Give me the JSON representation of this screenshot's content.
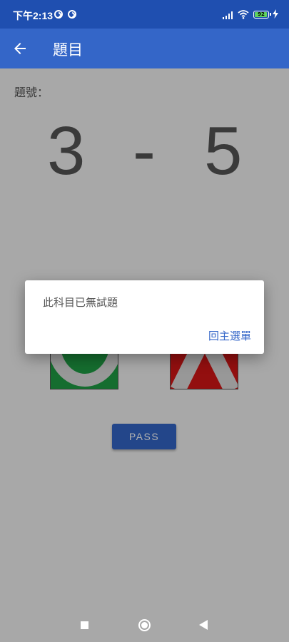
{
  "status_bar": {
    "time": "下午2:13",
    "battery_level": "92"
  },
  "app_bar": {
    "title": "題目",
    "back_icon": "arrow-left-icon"
  },
  "content": {
    "question_number_label": "題號：",
    "question_number": {
      "chapter": "3",
      "separator": "-",
      "number": "5"
    },
    "answer_options": [
      {
        "name": "correct-o",
        "color": "#1f9e44"
      },
      {
        "name": "wrong-x",
        "color": "#d61616"
      }
    ],
    "pass_button": "PASS"
  },
  "dialog": {
    "message": "此科目已無試題",
    "action": "回主選單"
  },
  "nav_bar": {
    "buttons": [
      "recents-icon",
      "home-icon",
      "back-icon"
    ]
  },
  "colors": {
    "status_bar": "#1f4fb0",
    "app_bar": "#3466c8",
    "accent": "#3466c8"
  }
}
